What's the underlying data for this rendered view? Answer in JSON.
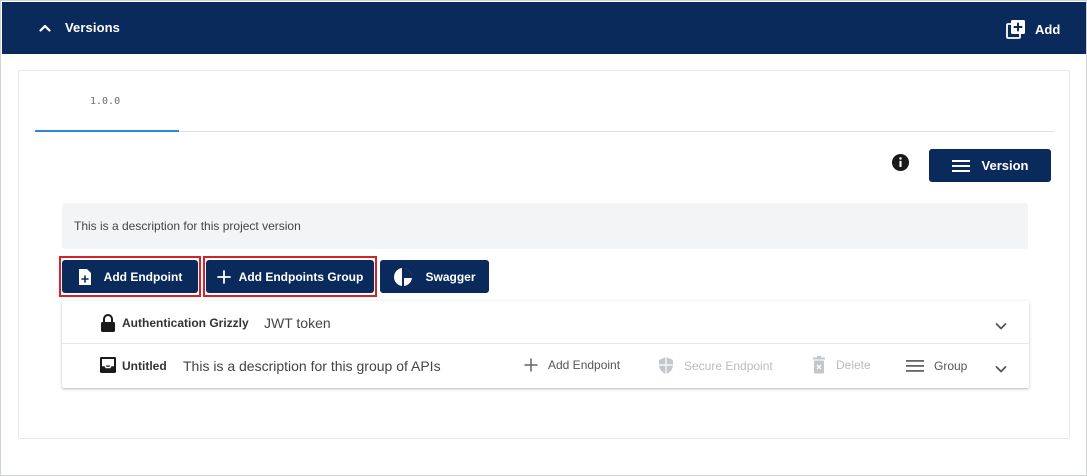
{
  "header": {
    "title": "Versions",
    "add_label": "Add",
    "colors": {
      "bar": "#0a2a5c",
      "text": "#ffffff"
    }
  },
  "tabs": [
    {
      "label": "1.0.0",
      "active": true
    }
  ],
  "version_button": {
    "label": "Version"
  },
  "description": "This is a description for this project version",
  "actions": {
    "add_endpoint": "Add Endpoint",
    "add_endpoints_group": "Add Endpoints Group",
    "swagger": "Swagger"
  },
  "groups": [
    {
      "name": "Authentication Grizzly",
      "description": "JWT token",
      "icon": "lock-icon"
    },
    {
      "name": "Untitled",
      "description": "This is a description for this group of APIs",
      "icon": "inbox-icon",
      "actions": {
        "add_endpoint": "Add Endpoint",
        "secure_endpoint": "Secure Endpoint",
        "delete": "Delete",
        "group": "Group"
      }
    }
  ],
  "colors": {
    "primary": "#0a2a5c",
    "tab_underline": "#2a87d6",
    "highlight": "#d2232a"
  }
}
